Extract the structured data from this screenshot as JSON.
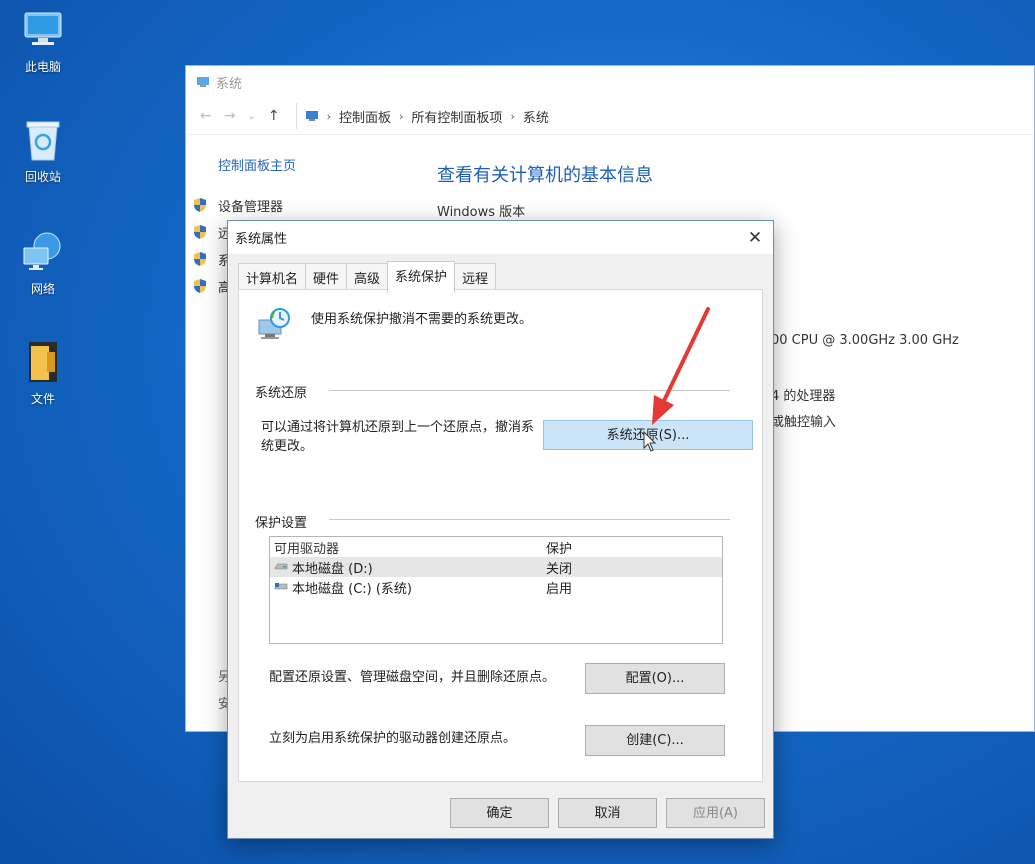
{
  "desktop": {
    "icons": [
      {
        "label": "此电脑",
        "icon": "computer-icon"
      },
      {
        "label": "回收站",
        "icon": "recycle-bin-icon"
      },
      {
        "label": "网络",
        "icon": "network-icon"
      },
      {
        "label": "文件",
        "icon": "folder-icon"
      }
    ]
  },
  "control_panel": {
    "title": "系统",
    "breadcrumb": [
      "控制面板",
      "所有控制面板项",
      "系统"
    ],
    "left_nav": {
      "home": "控制面板主页",
      "items": [
        "设备管理器",
        "远",
        "系",
        "高"
      ]
    },
    "heading": "查看有关计算机的基本信息",
    "windows_edition_label": "Windows 版本",
    "info": {
      "cpu": "00 CPU @ 3.00GHz   3.00 GHz",
      "processor": "4 的处理器",
      "touch": "或触控输入"
    },
    "bottom_left": [
      "另",
      "安"
    ]
  },
  "dialog": {
    "title": "系统属性",
    "tabs": [
      "计算机名",
      "硬件",
      "高级",
      "系统保护",
      "远程"
    ],
    "active_tab": "系统保护",
    "description": "使用系统保护撤消不需要的系统更改。",
    "restore_section": {
      "label": "系统还原",
      "text": "可以通过将计算机还原到上一个还原点，撤消系统更改。",
      "button": "系统还原(S)..."
    },
    "protection_section": {
      "label": "保护设置",
      "columns": [
        "可用驱动器",
        "保护"
      ],
      "rows": [
        {
          "drive": "本地磁盘 (D:)",
          "protection": "关闭"
        },
        {
          "drive": "本地磁盘 (C:) (系统)",
          "protection": "启用"
        }
      ],
      "configure_text": "配置还原设置、管理磁盘空间，并且删除还原点。",
      "configure_button": "配置(O)...",
      "create_text": "立刻为启用系统保护的驱动器创建还原点。",
      "create_button": "创建(C)..."
    },
    "footer": {
      "ok": "确定",
      "cancel": "取消",
      "apply": "应用(A)"
    }
  },
  "colors": {
    "accent": "#1e5fb6",
    "highlight_button": "#cce4f7",
    "annotation_arrow": "#e53935"
  }
}
